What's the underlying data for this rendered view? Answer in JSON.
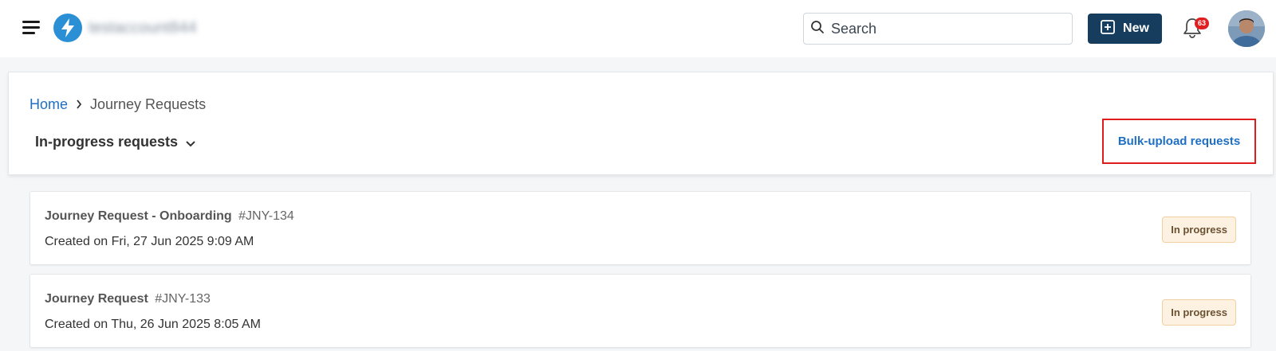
{
  "topbar": {
    "account_name": "testaccount844",
    "search_placeholder": "Search",
    "new_button_label": "New",
    "notification_count": "63"
  },
  "breadcrumb": {
    "home": "Home",
    "current": "Journey Requests"
  },
  "filter": {
    "label": "In-progress requests"
  },
  "actions": {
    "bulk_upload_label": "Bulk-upload requests"
  },
  "requests": [
    {
      "title": "Journey Request - Onboarding",
      "id": "#JNY-134",
      "created": "Created on Fri, 27 Jun 2025 9:09 AM",
      "status": "In progress"
    },
    {
      "title": "Journey Request",
      "id": "#JNY-133",
      "created": "Created on Thu, 26 Jun 2025 8:05 AM",
      "status": "In progress"
    }
  ],
  "colors": {
    "brand": "#2b8fd6",
    "primary_button": "#163c5e",
    "link": "#1f6fc5",
    "highlight_border": "#e01b1b",
    "status_bg": "#fdf1e1",
    "badge": "#e02020"
  }
}
